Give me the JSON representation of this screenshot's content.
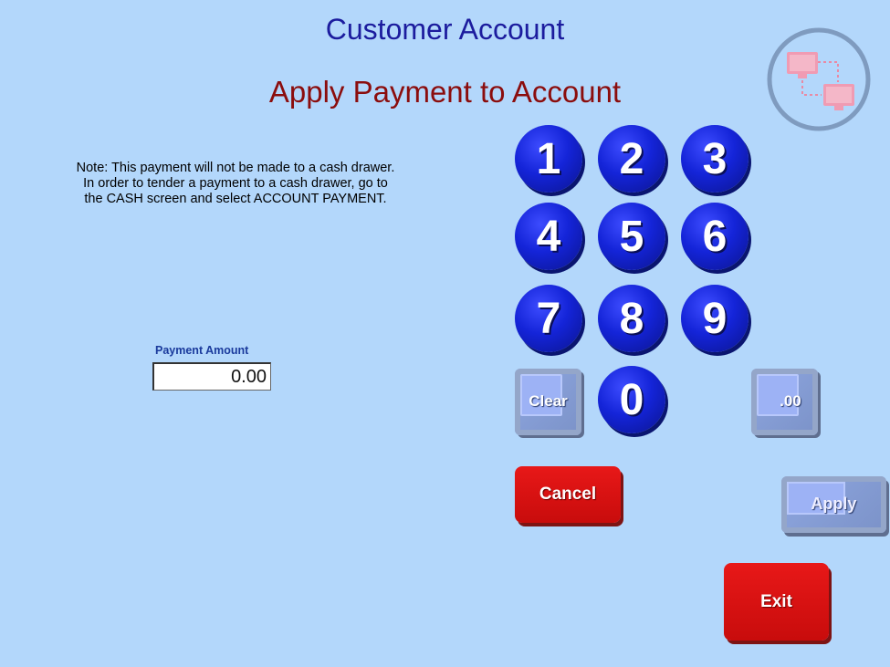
{
  "header": {
    "title": "Customer Account",
    "subtitle": "Apply Payment to Account"
  },
  "note": {
    "text": "Note: This payment will not be made to a cash drawer.  In order to tender a payment to a cash drawer, go to the CASH screen and select ACCOUNT PAYMENT."
  },
  "payment": {
    "label": "Payment Amount",
    "value": "0.00"
  },
  "keypad": {
    "keys": [
      "1",
      "2",
      "3",
      "4",
      "5",
      "6",
      "7",
      "8",
      "9",
      "0"
    ],
    "clear_label": "Clear",
    "decimal_label": ".00"
  },
  "actions": {
    "cancel_label": "Cancel",
    "apply_label": "Apply",
    "exit_label": "Exit"
  },
  "icons": {
    "logo": "network-computers-icon"
  },
  "colors": {
    "background": "#b3d7fb",
    "title": "#1c1c9e",
    "subtitle": "#8b0d0d",
    "key": "#1424d8",
    "danger": "#d01010"
  }
}
